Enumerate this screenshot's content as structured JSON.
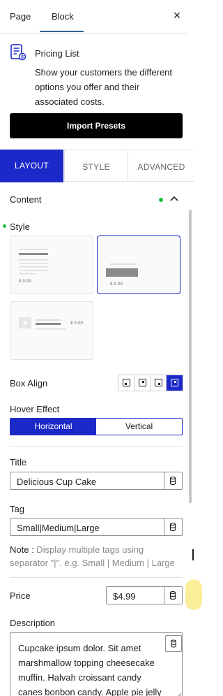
{
  "top_tabs": {
    "page": "Page",
    "block": "Block"
  },
  "close_glyph": "×",
  "block": {
    "icon": "pricing-list-icon",
    "title": "Pricing List",
    "description": "Show your customers the different options you offer and their associated costs."
  },
  "import_button": "Import Presets",
  "panel_tabs": {
    "layout": "LAYOUT",
    "style": "STYLE",
    "advanced": "ADVANCED"
  },
  "content_section": {
    "label": "Content",
    "expanded": true
  },
  "style_section": {
    "label": "Style",
    "presets": [
      {
        "price": "$ 0.00",
        "selected": false
      },
      {
        "price": "$ 0.00",
        "selected": true
      },
      {
        "price": "$ 0.00",
        "selected": false
      }
    ]
  },
  "box_align": {
    "label": "Box Align",
    "options": [
      "bottom-left",
      "top-right",
      "bottom-right",
      "top-right-active"
    ],
    "selected_index": 3
  },
  "hover_effect": {
    "label": "Hover Effect",
    "options": [
      "Horizontal",
      "Vertical"
    ],
    "selected": "Horizontal"
  },
  "title_field": {
    "label": "Title",
    "value": "Delicious Cup Cake"
  },
  "tag_field": {
    "label": "Tag",
    "value": "Small|Medium|Large",
    "note_label": "Note :",
    "note_text": " Display multiple tags using separator \"|\". e.g. Small | Medium | Large"
  },
  "price_field": {
    "label": "Price",
    "value": "$4.99"
  },
  "description_field": {
    "label": "Description",
    "value": "Cupcake ipsum dolor. Sit amet marshmallow topping cheesecake muffin. Halvah croissant candy canes bonbon candy. Apple pie jelly beans"
  },
  "colors": {
    "accent": "#1c29c9",
    "status_dot": "#1fbe3a"
  }
}
